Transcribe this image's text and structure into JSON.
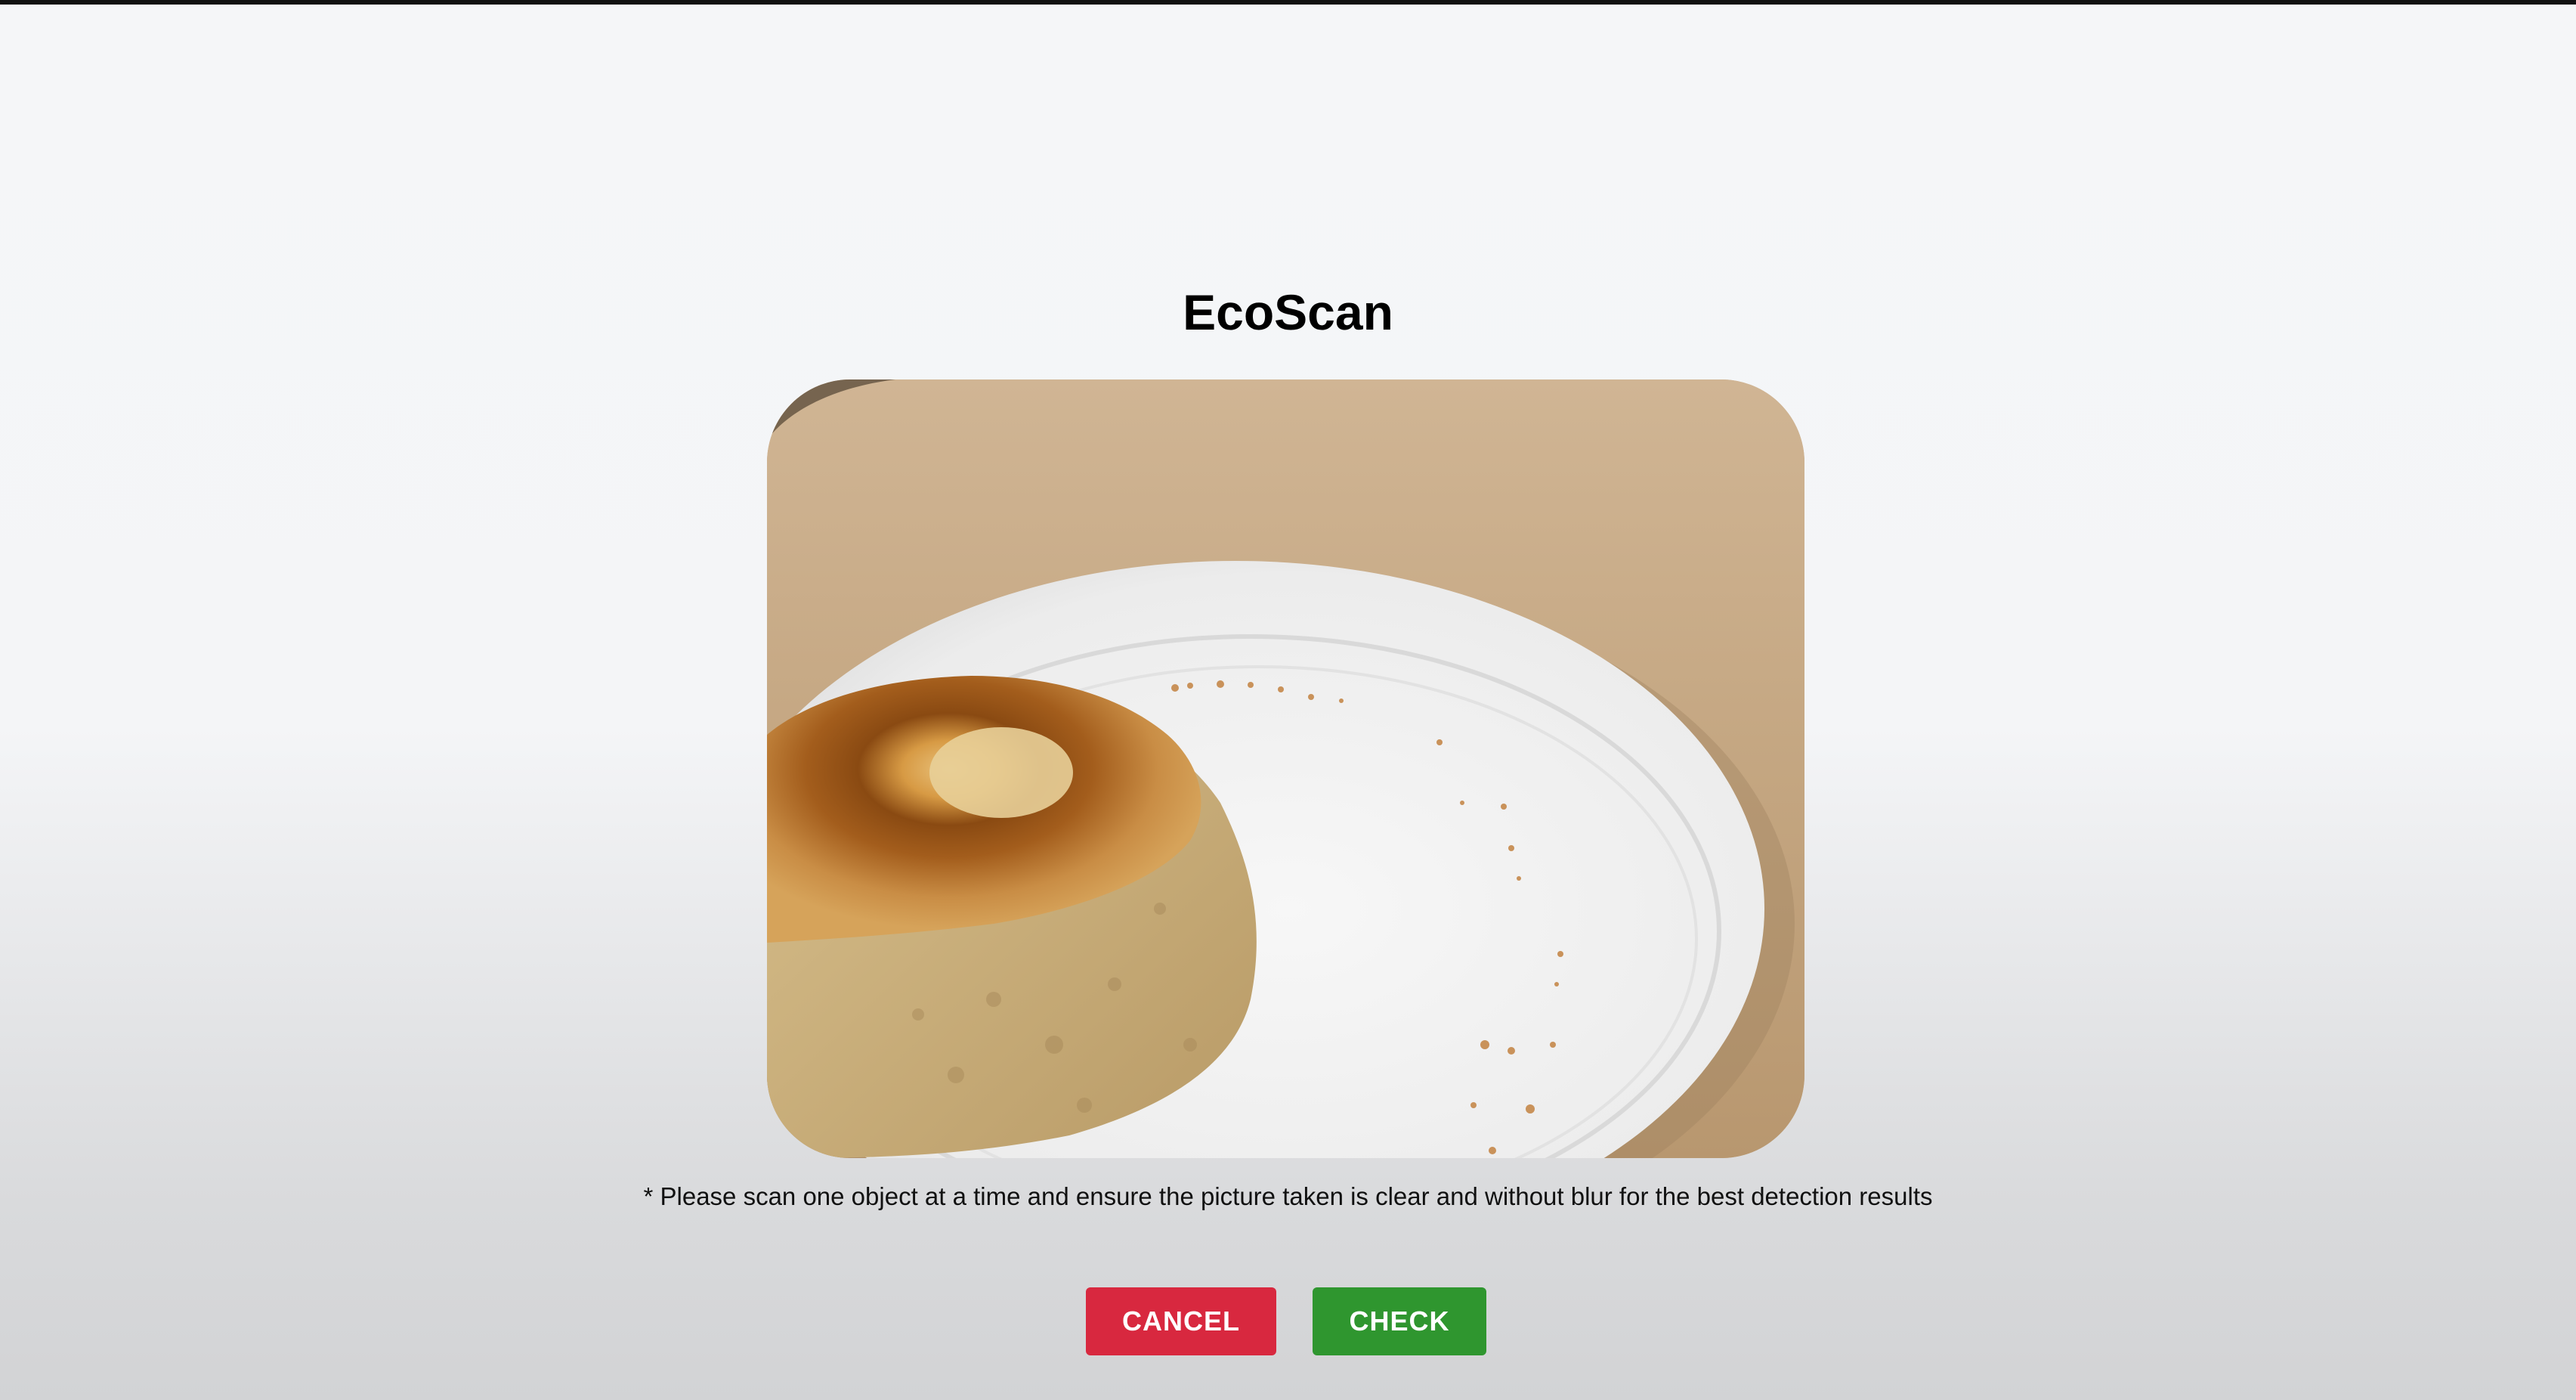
{
  "app": {
    "title": "EcoScan"
  },
  "camera": {
    "subject": "bread-on-paper-plate"
  },
  "hint": {
    "text": "* Please scan one object at a time and ensure the picture taken is clear and without blur for the best detection results"
  },
  "actions": {
    "cancel_label": "CANCEL",
    "check_label": "CHECK"
  },
  "colors": {
    "cancel": "#d8283f",
    "check": "#2f962f",
    "background": "#f5f6f8"
  }
}
